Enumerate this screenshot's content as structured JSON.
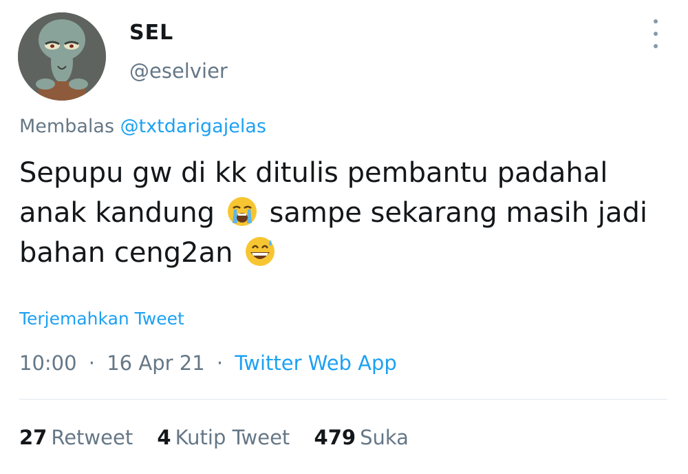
{
  "author": {
    "name": "SEL",
    "handle": "@eselvier",
    "avatar": "squidward-avatar"
  },
  "menu": {
    "icon": "more-vertical-icon"
  },
  "reply": {
    "prefix": "Membalas",
    "mention": "@txtdarigajelas"
  },
  "tweet": {
    "text_part1": "Sepupu gw di kk ditulis pembantu padahal anak kandung",
    "emoji1": "loudly-crying-face-emoji",
    "text_part2": "sampe sekarang masih jadi bahan ceng2an",
    "emoji2": "grinning-face-with-sweat-emoji"
  },
  "translate_label": "Terjemahkan Tweet",
  "meta": {
    "time": "10:00",
    "date": "16 Apr 21",
    "source": "Twitter Web App",
    "separator": "·"
  },
  "stats": {
    "retweets": {
      "count": "27",
      "label": "Retweet"
    },
    "quotes": {
      "count": "4",
      "label": "Kutip Tweet"
    },
    "likes": {
      "count": "479",
      "label": "Suka"
    }
  },
  "colors": {
    "link": "#1da1f2",
    "secondary": "#657786",
    "primary": "#14171a",
    "divider": "#e1e8ed"
  }
}
